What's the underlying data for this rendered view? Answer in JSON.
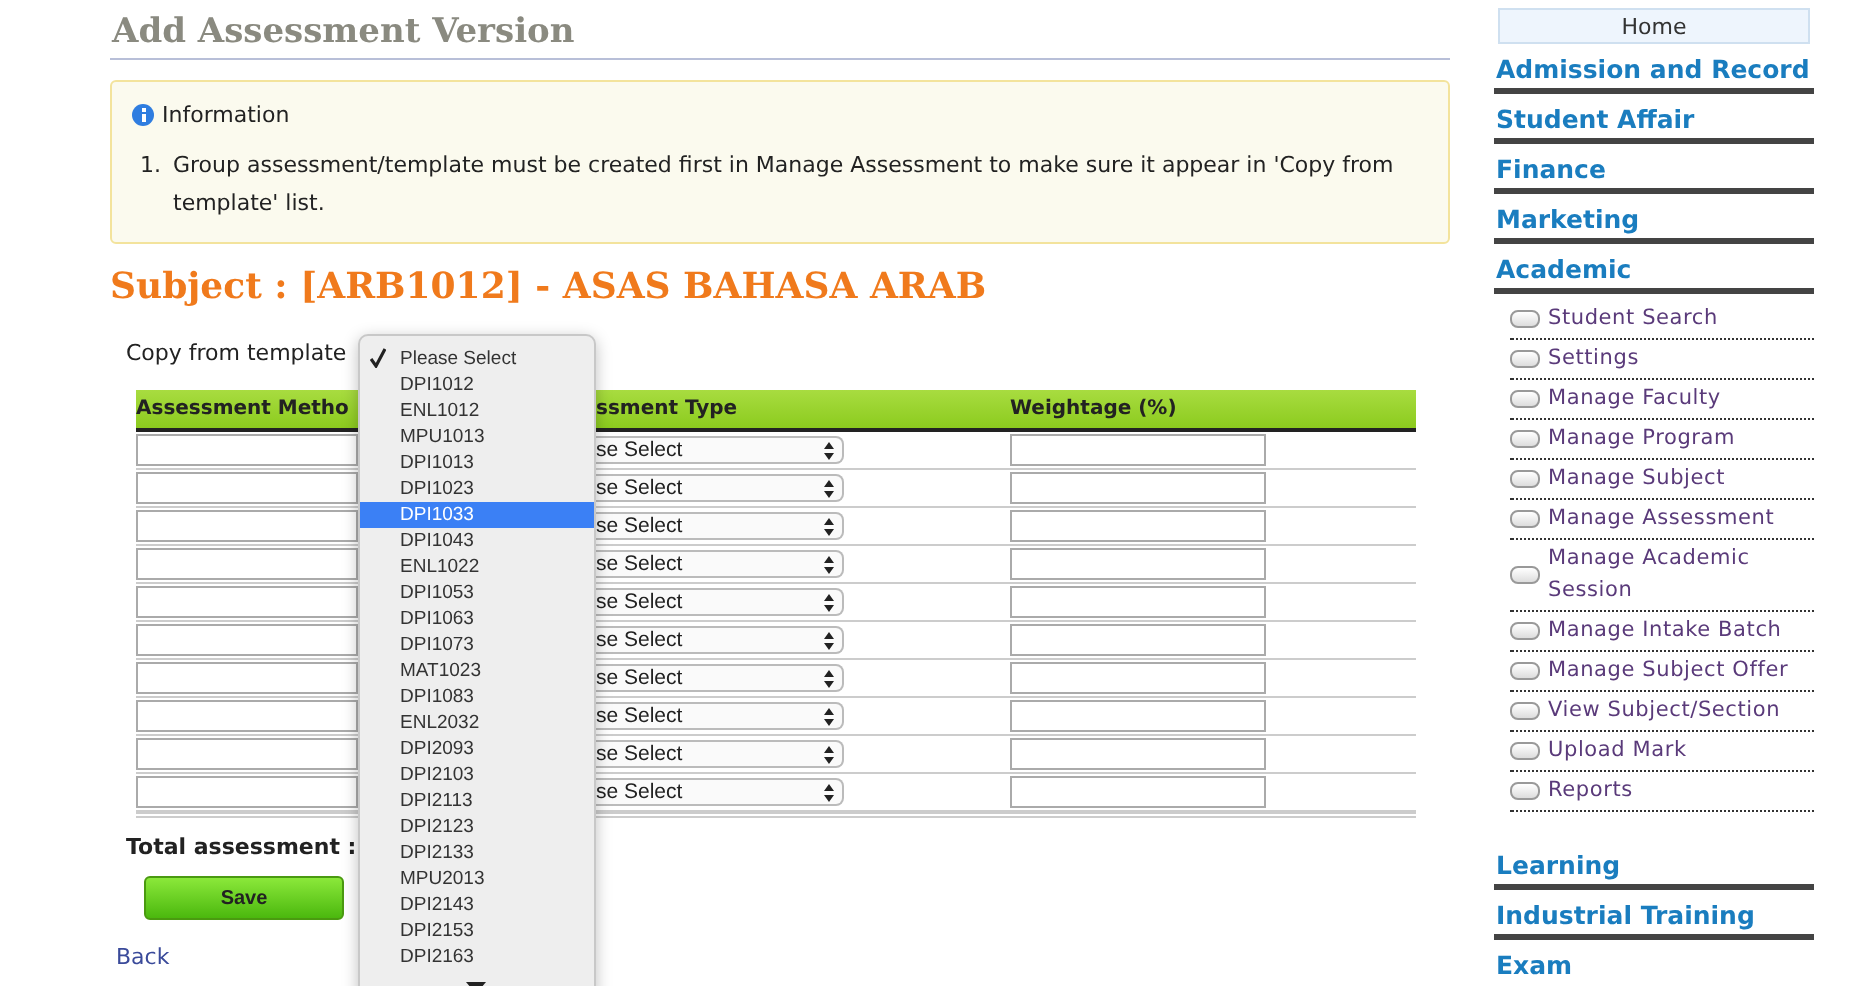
{
  "page_title": "Add Assessment Version",
  "info": {
    "title": "Information",
    "items": [
      {
        "number": "1.",
        "text": "Group assessment/template must be created first in Manage Assessment to make sure it appear in 'Copy from template' list."
      }
    ]
  },
  "subject": "Subject : [ARB1012] - ASAS BAHASA ARAB",
  "copy_from_template": {
    "label": "Copy from template",
    "options": [
      {
        "label": "Please Select",
        "checked": true,
        "selected": false
      },
      {
        "label": "DPI1012",
        "checked": false,
        "selected": false
      },
      {
        "label": "ENL1012",
        "checked": false,
        "selected": false
      },
      {
        "label": "MPU1013",
        "checked": false,
        "selected": false
      },
      {
        "label": "DPI1013",
        "checked": false,
        "selected": false
      },
      {
        "label": "DPI1023",
        "checked": false,
        "selected": false
      },
      {
        "label": "DPI1033",
        "checked": false,
        "selected": true
      },
      {
        "label": "DPI1043",
        "checked": false,
        "selected": false
      },
      {
        "label": "ENL1022",
        "checked": false,
        "selected": false
      },
      {
        "label": "DPI1053",
        "checked": false,
        "selected": false
      },
      {
        "label": "DPI1063",
        "checked": false,
        "selected": false
      },
      {
        "label": "DPI1073",
        "checked": false,
        "selected": false
      },
      {
        "label": "MAT1023",
        "checked": false,
        "selected": false
      },
      {
        "label": "DPI1083",
        "checked": false,
        "selected": false
      },
      {
        "label": "ENL2032",
        "checked": false,
        "selected": false
      },
      {
        "label": "DPI2093",
        "checked": false,
        "selected": false
      },
      {
        "label": "DPI2103",
        "checked": false,
        "selected": false
      },
      {
        "label": "DPI2113",
        "checked": false,
        "selected": false
      },
      {
        "label": "DPI2123",
        "checked": false,
        "selected": false
      },
      {
        "label": "DPI2133",
        "checked": false,
        "selected": false
      },
      {
        "label": "MPU2013",
        "checked": false,
        "selected": false
      },
      {
        "label": "DPI2143",
        "checked": false,
        "selected": false
      },
      {
        "label": "DPI2153",
        "checked": false,
        "selected": false
      },
      {
        "label": "DPI2163",
        "checked": false,
        "selected": false
      }
    ]
  },
  "table": {
    "columns": [
      "Assessment Metho",
      "ssment Type",
      "Weightage (%)"
    ],
    "rows": [
      {
        "assessment_type": "se Select"
      },
      {
        "assessment_type": "se Select"
      },
      {
        "assessment_type": "se Select"
      },
      {
        "assessment_type": "se Select"
      },
      {
        "assessment_type": "se Select"
      },
      {
        "assessment_type": "se Select"
      },
      {
        "assessment_type": "se Select"
      },
      {
        "assessment_type": "se Select"
      },
      {
        "assessment_type": "se Select"
      },
      {
        "assessment_type": "se Select"
      }
    ]
  },
  "total_label": "Total assessment :",
  "save_button": "Save",
  "back_link": "Back",
  "sidebar": {
    "home": "Home",
    "sections": [
      {
        "label": "Admission and Record"
      },
      {
        "label": "Student Affair"
      },
      {
        "label": "Finance"
      },
      {
        "label": "Marketing"
      },
      {
        "label": "Academic",
        "children": [
          "Student Search",
          "Settings",
          "Manage Faculty",
          "Manage Program",
          "Manage Subject",
          "Manage Assessment",
          "Manage Academic Session",
          "Manage Intake Batch",
          "Manage Subject Offer",
          "View Subject/Section",
          "Upload Mark",
          "Reports"
        ]
      },
      {
        "label": "Learning"
      },
      {
        "label": "Industrial Training"
      },
      {
        "label": "Exam"
      }
    ]
  }
}
